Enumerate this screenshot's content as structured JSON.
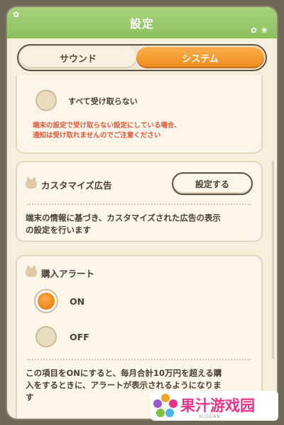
{
  "header": {
    "title": "設定"
  },
  "tabs": [
    {
      "label": "サウンド",
      "active": false
    },
    {
      "label": "システム",
      "active": true
    }
  ],
  "notification": {
    "option_label": "すべて受け取らない",
    "warning": [
      "端末の設定で受け取らない設定にしている場合、",
      "通知は受け取れませんのでご注意ください"
    ]
  },
  "custom_ads": {
    "title": "カスタマイズ広告",
    "button_label": "設定する",
    "description": [
      "端末の情報に基づき、カスタマイズされた広告の表示",
      "の設定を行います"
    ]
  },
  "purchase_alert": {
    "title": "購入アラート",
    "options": [
      {
        "label": "ON",
        "selected": true
      },
      {
        "label": "OFF",
        "selected": false
      }
    ],
    "description": [
      "この項目をONにすると、毎月合計10万円を超える購",
      "入をするときに、アラートが表示されるようになりま",
      "す"
    ]
  },
  "watermark": {
    "text": "果汁游戏园",
    "slogan": "SLOGAN"
  },
  "colors": {
    "accent": "#f08a1e",
    "header": "#8dc05e",
    "warning": "#e0573b"
  }
}
